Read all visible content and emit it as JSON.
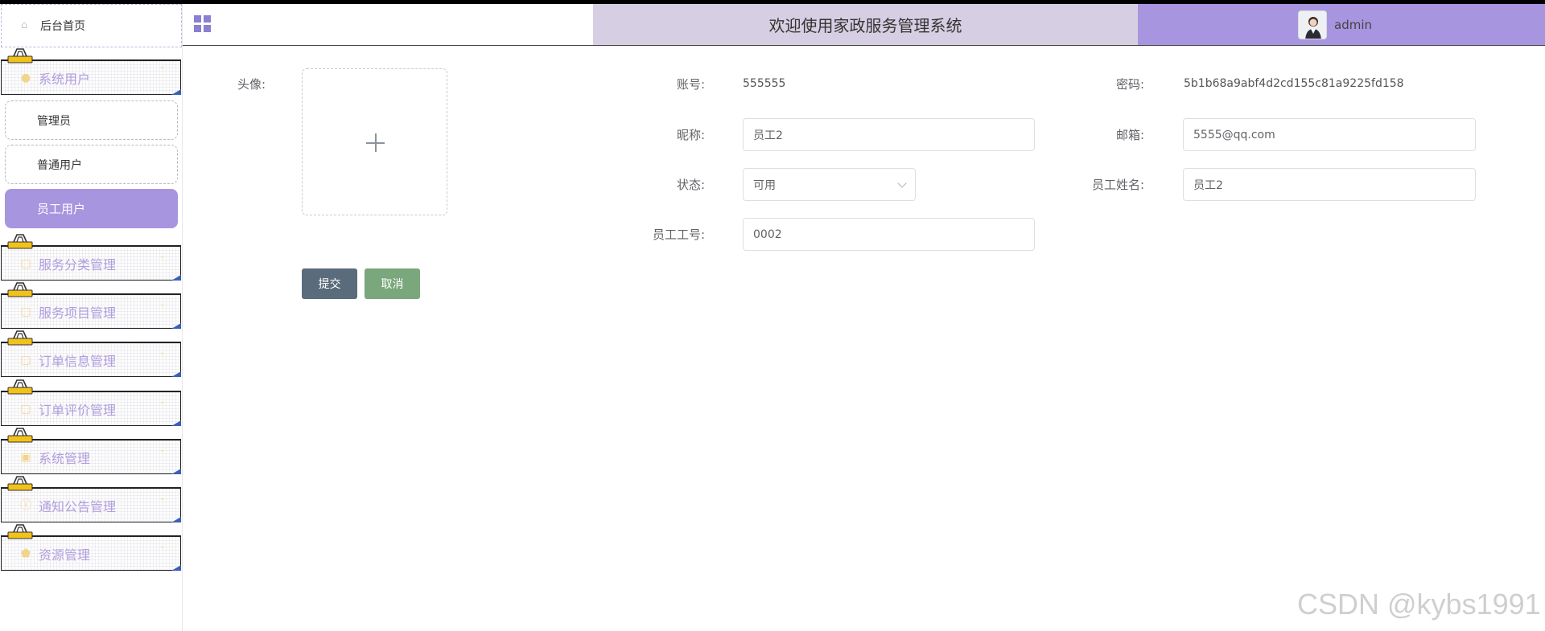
{
  "colors": {
    "accent": "#a895df",
    "title_bg": "#d6cee2",
    "submit_bg": "#5a6b7b",
    "cancel_bg": "#7aa77c"
  },
  "sidebar": {
    "home": {
      "label": "后台首页",
      "icon": "home-icon"
    },
    "groups": [
      {
        "label": "系统用户",
        "icon": "user-icon",
        "expanded": true,
        "items": [
          {
            "label": "管理员"
          },
          {
            "label": "普通用户"
          },
          {
            "label": "员工用户",
            "active": true
          }
        ]
      },
      {
        "label": "服务分类管理",
        "icon": "document-icon"
      },
      {
        "label": "服务项目管理",
        "icon": "document-icon"
      },
      {
        "label": "订单信息管理",
        "icon": "document-icon"
      },
      {
        "label": "订单评价管理",
        "icon": "document-icon"
      },
      {
        "label": "系统管理",
        "icon": "picture-icon"
      },
      {
        "label": "通知公告管理",
        "icon": "info-icon"
      },
      {
        "label": "资源管理",
        "icon": "shield-icon"
      }
    ]
  },
  "header": {
    "title": "欢迎使用家政服务管理系统",
    "username": "admin"
  },
  "form": {
    "avatar_label": "头像:",
    "account_label": "账号:",
    "account_value": "555555",
    "password_label": "密码:",
    "password_value": "5b1b68a9abf4d2cd155c81a9225fd158",
    "nickname_label": "昵称:",
    "nickname_value": "员工2",
    "email_label": "邮箱:",
    "email_value": "5555@qq.com",
    "status_label": "状态:",
    "status_value": "可用",
    "employee_name_label": "员工姓名:",
    "employee_name_value": "员工2",
    "employee_no_label": "员工工号:",
    "employee_no_value": "0002",
    "submit_label": "提交",
    "cancel_label": "取消"
  },
  "watermark": "CSDN @kybs1991"
}
